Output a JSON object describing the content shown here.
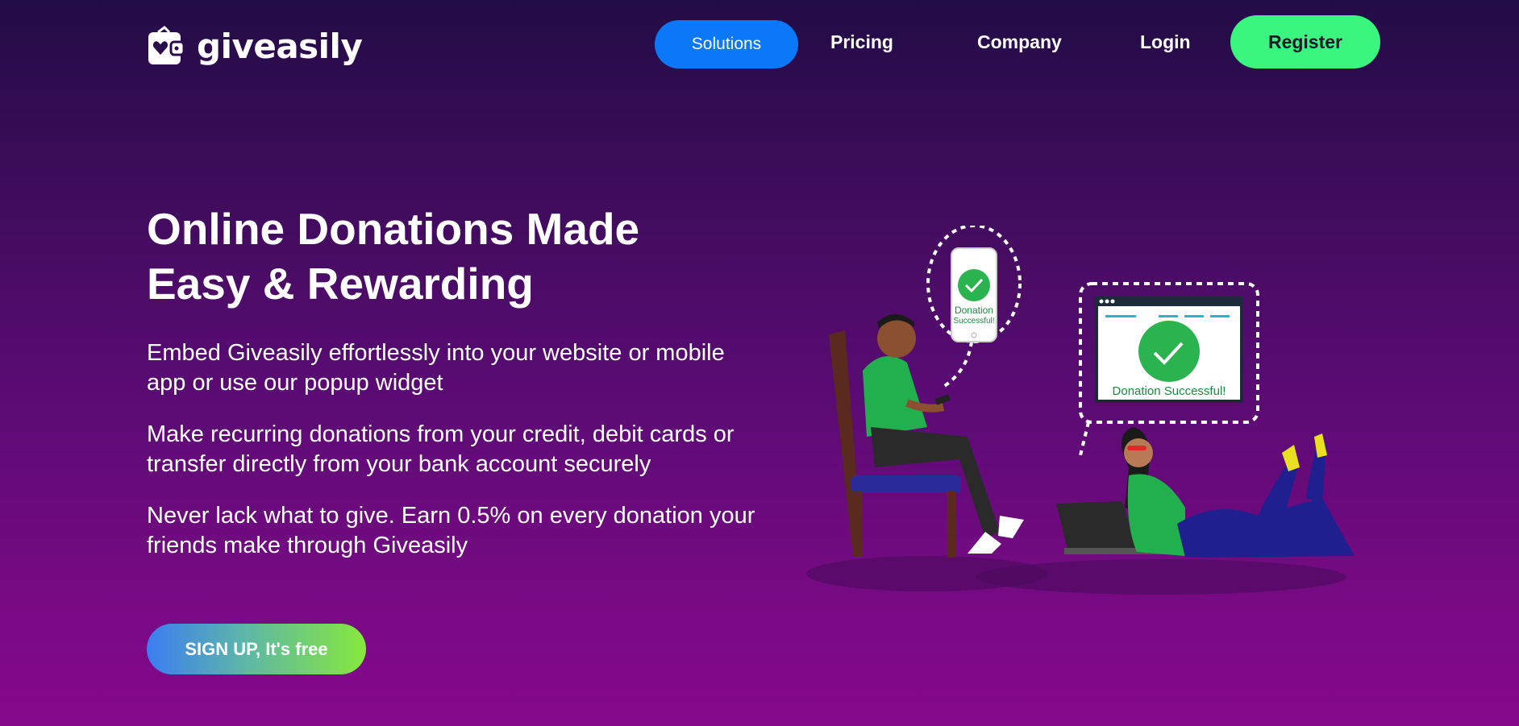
{
  "brand": {
    "name": "giveasily",
    "logo_icon": "wallet-heart-icon"
  },
  "nav": {
    "solutions": "Solutions",
    "pricing": "Pricing",
    "company": "Company",
    "login": "Login",
    "register": "Register"
  },
  "hero": {
    "title": "Online Donations Made Easy & Rewarding",
    "paragraphs": [
      "Embed Giveasily effortlessly into your website or mobile app or use our popup widget",
      "Make recurring donations from your credit, debit cards or transfer directly from your bank account securely",
      "Never lack what to give. Earn 0.5% on every donation your friends make through Giveasily"
    ],
    "cta": "SIGN UP, It's free"
  },
  "illustration": {
    "phone_text_line1": "Donation",
    "phone_text_line2": "Successful!",
    "browser_text": "Donation Successful!"
  },
  "colors": {
    "solutions_bg": "#0a78f7",
    "register_bg": "#3af57e",
    "success_green": "#2bb34f"
  }
}
